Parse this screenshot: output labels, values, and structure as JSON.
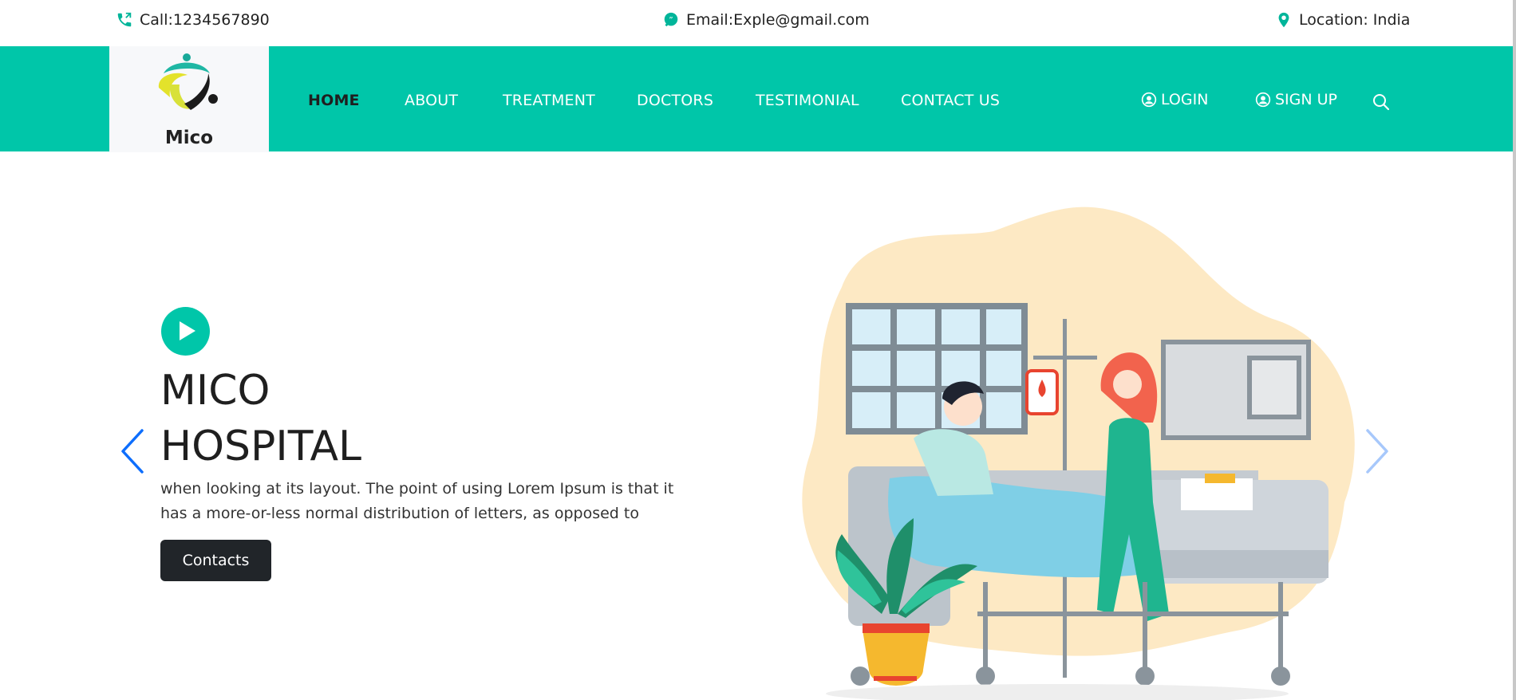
{
  "topbar": {
    "call": "Call:1234567890",
    "email": "Email:Exple@gmail.com",
    "location": "Location: India",
    "icons": {
      "call": "phone-icon",
      "email": "chat-bubble-icon",
      "location": "map-pin-icon"
    }
  },
  "brand": {
    "name": "Mico"
  },
  "nav": {
    "items": [
      {
        "label": "HOME",
        "active": true
      },
      {
        "label": "ABOUT"
      },
      {
        "label": "TREATMENT"
      },
      {
        "label": "DOCTORS"
      },
      {
        "label": "TESTIMONIAL"
      },
      {
        "label": "CONTACT US"
      }
    ],
    "login": "LOGIN",
    "signup": "SIGN UP"
  },
  "hero": {
    "title_line1": "MICO",
    "title_line2": "HOSPITAL",
    "text": "when looking at its layout. The point of using Lorem Ipsum is that it has a more-or-less normal distribution of letters, as opposed to",
    "button": "Contacts"
  },
  "colors": {
    "accent": "#00c6a9",
    "dark": "#212529",
    "arrow": "#0d6efd",
    "illustration_bg": "#fde9c4"
  }
}
